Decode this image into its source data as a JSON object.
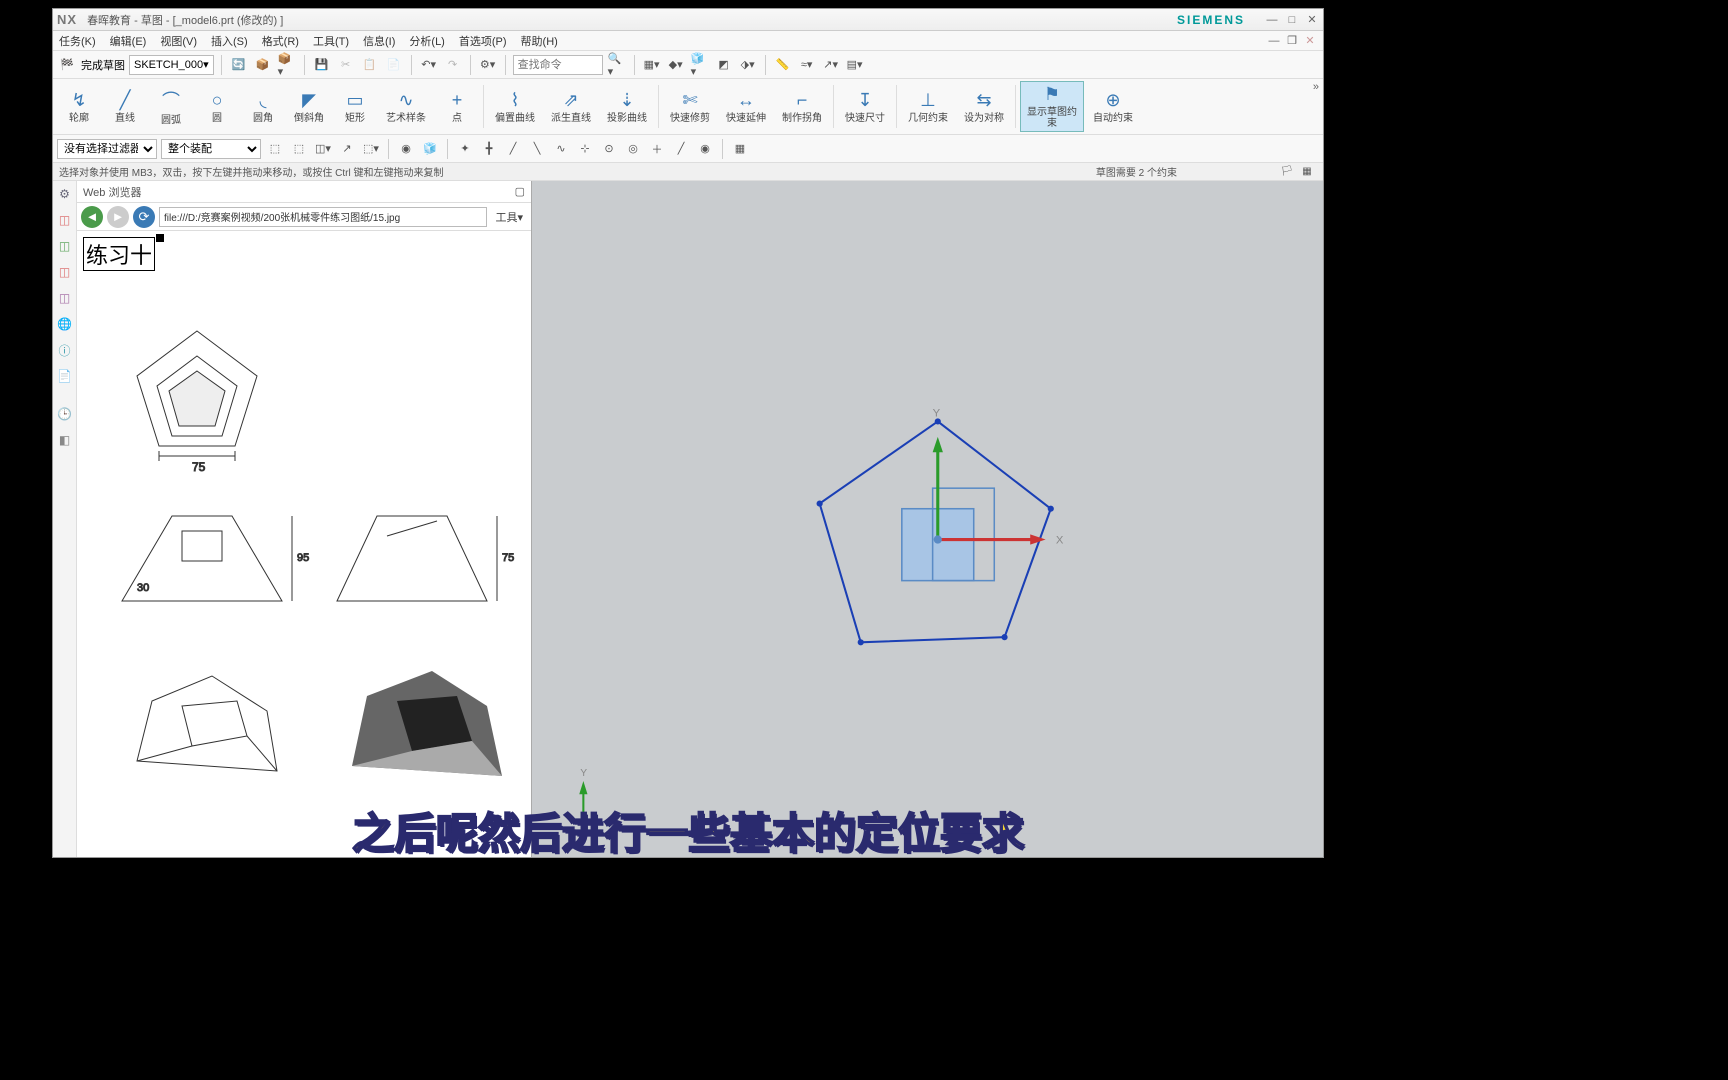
{
  "title": {
    "nx": "NX",
    "text": "春晖教育 - 草图 - [_model6.prt  (修改的)  ]",
    "siemens": "SIEMENS"
  },
  "menu": [
    "任务(K)",
    "编辑(E)",
    "视图(V)",
    "插入(S)",
    "格式(R)",
    "工具(T)",
    "信息(I)",
    "分析(L)",
    "首选项(P)",
    "帮助(H)"
  ],
  "tb1": {
    "finish_sketch": "完成草图",
    "sketch_name": "SKETCH_000",
    "search_placeholder": "查找命令"
  },
  "ribbon": [
    {
      "label": "轮廓",
      "icon": "↯"
    },
    {
      "label": "直线",
      "icon": "╱"
    },
    {
      "label": "圆弧",
      "icon": "⌒"
    },
    {
      "label": "圆",
      "icon": "○"
    },
    {
      "label": "圆角",
      "icon": "◟"
    },
    {
      "label": "倒斜角",
      "icon": "◤"
    },
    {
      "label": "矩形",
      "icon": "▭"
    },
    {
      "label": "艺术样条",
      "icon": "∿"
    },
    {
      "label": "点",
      "icon": "+"
    },
    {
      "label": "偏置曲线",
      "icon": "⌇"
    },
    {
      "label": "派生直线",
      "icon": "⇗"
    },
    {
      "label": "投影曲线",
      "icon": "⇣"
    },
    {
      "label": "快速修剪",
      "icon": "✄"
    },
    {
      "label": "快速延伸",
      "icon": "↔"
    },
    {
      "label": "制作拐角",
      "icon": "⌐"
    },
    {
      "label": "快速尺寸",
      "icon": "↧"
    },
    {
      "label": "几何约束",
      "icon": "⊥"
    },
    {
      "label": "设为对称",
      "icon": "⇆"
    },
    {
      "label": "显示草图约\n束",
      "icon": "⚑",
      "highlight": true
    },
    {
      "label": "自动约束",
      "icon": "⊕"
    }
  ],
  "filters": {
    "f1": "没有选择过滤器",
    "f2": "整个装配"
  },
  "status": {
    "left": "选择对象并使用 MB3，双击，按下左键并拖动来移动，或按住 Ctrl 键和左键拖动来复制",
    "right": "草图需要 2 个约束"
  },
  "browser": {
    "header": "Web 浏览器",
    "url": "file:///D:/竞赛案例视频/200张机械零件练习图纸/15.jpg",
    "tools": "工具",
    "exercise_title": "练习十"
  },
  "drawing": {
    "dim_75": "75",
    "dim_95": "95",
    "dim_30": "30",
    "dim_75b": "75"
  },
  "axes": {
    "x": "X",
    "y": "Y"
  },
  "caption": "之后呢然后进行一些基本的定位要求"
}
